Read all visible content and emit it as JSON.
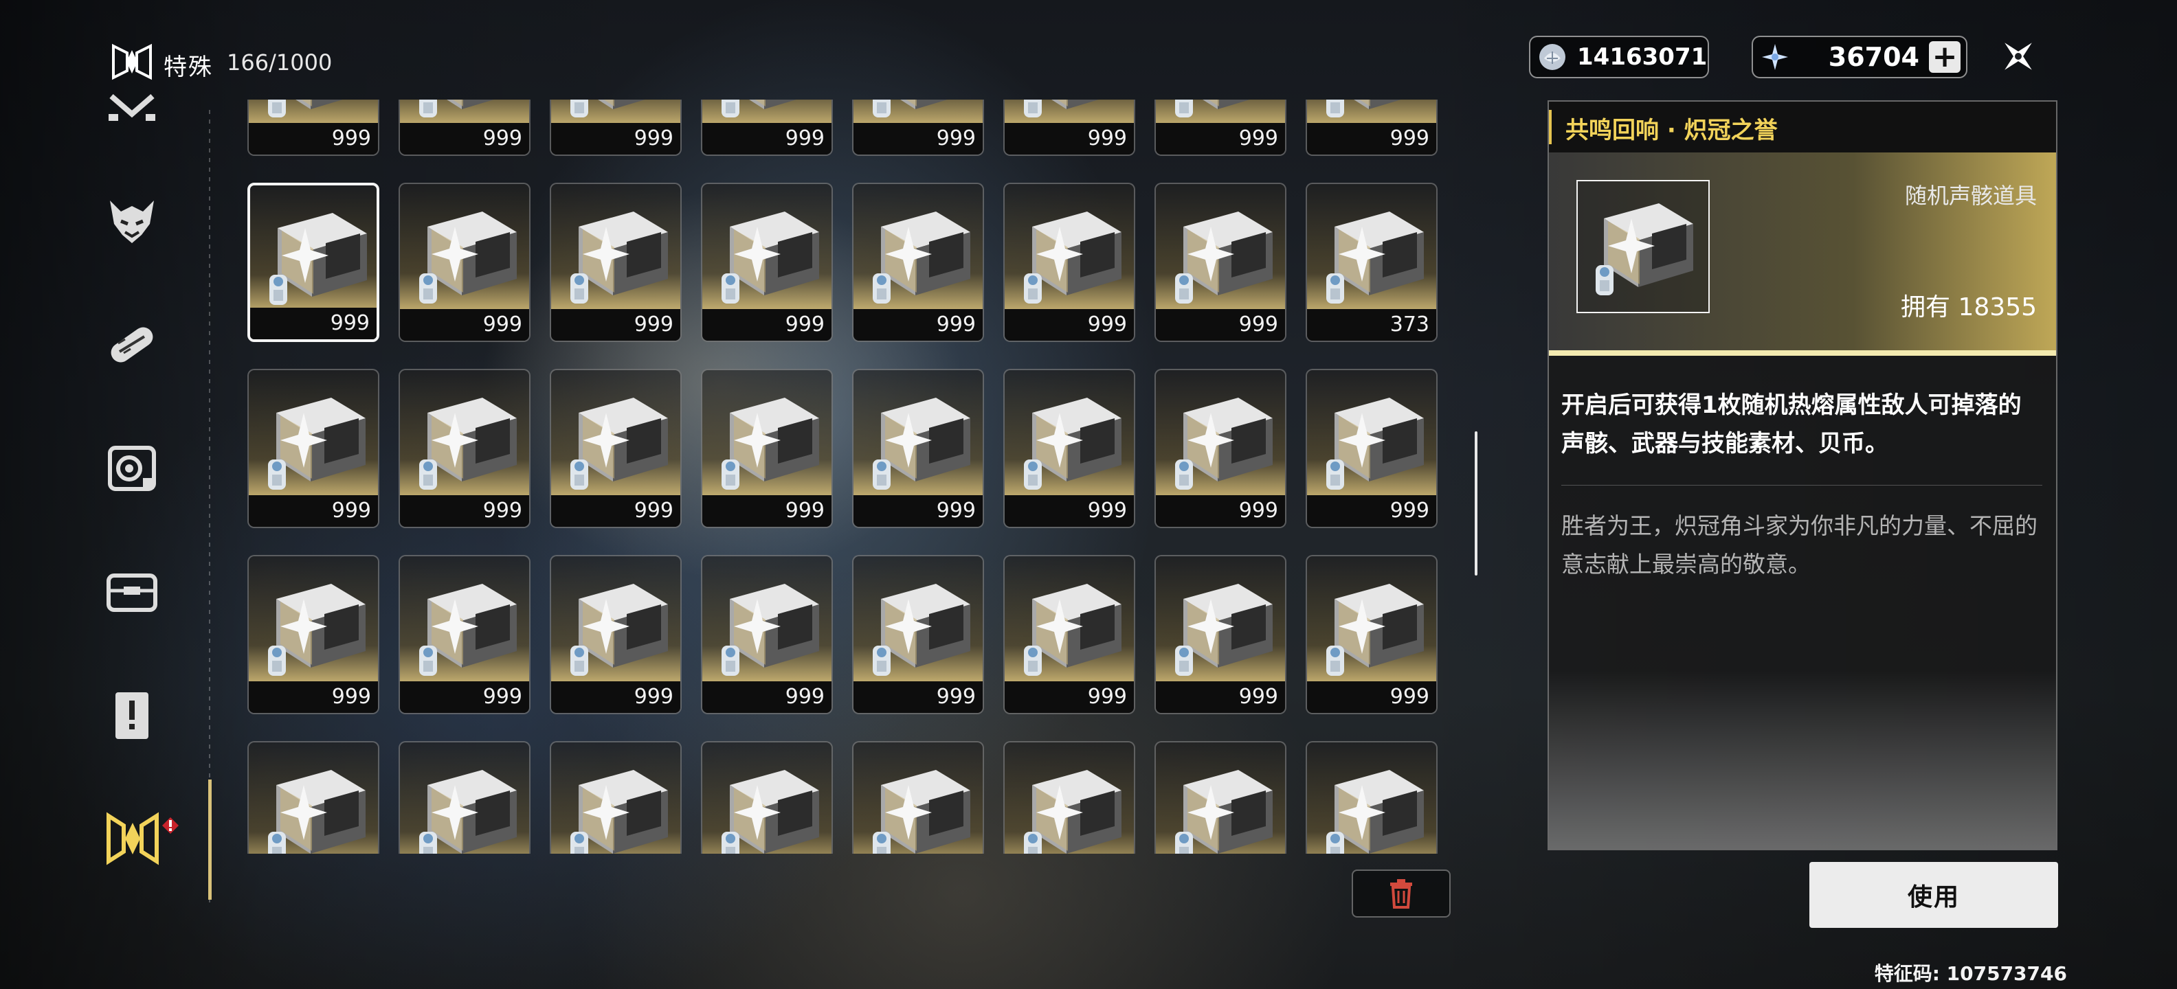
{
  "header": {
    "category_icon": "echo-crate-icon",
    "category_label": "特殊",
    "category_count": "166/1000",
    "currency_1": {
      "icon": "shell-credit-icon",
      "value": "14163071"
    },
    "currency_2": {
      "icon": "astrite-icon",
      "value": "36704",
      "add_icon": "plus-icon"
    },
    "close_icon": "close-star-icon"
  },
  "sidebar": {
    "items": [
      {
        "name": "materials-tab",
        "icon": "crossed-tools-icon"
      },
      {
        "name": "enemy-drop-tab",
        "icon": "demon-mask-icon"
      },
      {
        "name": "supplies-tab",
        "icon": "capsule-icon"
      },
      {
        "name": "resources-tab",
        "icon": "gear-target-icon"
      },
      {
        "name": "gadgets-tab",
        "icon": "toolbox-icon"
      },
      {
        "name": "quest-items-tab",
        "icon": "exclamation-card-icon"
      },
      {
        "name": "special-tab",
        "icon": "echo-crate-icon",
        "active": true,
        "alert_icon": "red-alert-badge-icon"
      }
    ]
  },
  "grid": {
    "item_icon": "echo-supply-crate-icon",
    "quantities": [
      "999",
      "999",
      "999",
      "999",
      "999",
      "999",
      "999",
      "999",
      "999",
      "999",
      "999",
      "999",
      "999",
      "999",
      "999",
      "373",
      "999",
      "999",
      "999",
      "999",
      "999",
      "999",
      "999",
      "999",
      "999",
      "999",
      "999",
      "999",
      "999",
      "999",
      "999",
      "999",
      "",
      "",
      "",
      "",
      "",
      "",
      "",
      ""
    ],
    "selected_index": 8,
    "delete_icon": "trash-icon"
  },
  "detail": {
    "title": "共鸣回响 · 炽冠之誉",
    "item_type": "随机声骸道具",
    "owned": "拥有 18355",
    "description": "开启后可获得1枚随机热熔属性敌人可掉落的声骸、武器与技能素材、贝币。",
    "lore": "胜者为王，炽冠角斗家为你非凡的力量、不屈的意志献上最崇高的敬意。",
    "use_label": "使用",
    "accent_color": "#f2d35a"
  },
  "footer": {
    "feature_code": "特征码: 107573746"
  }
}
